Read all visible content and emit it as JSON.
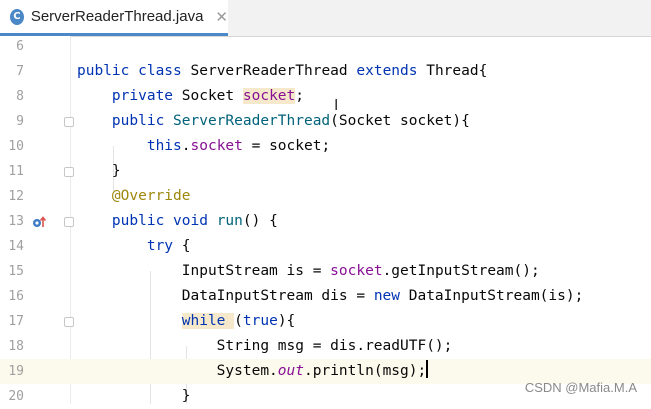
{
  "tab": {
    "icon_letter": "C",
    "label": "ServerReaderThread.java",
    "close": "✕"
  },
  "lines": [
    {
      "n": "6",
      "tokens": []
    },
    {
      "n": "7",
      "tokens": [
        {
          "t": "public class ",
          "c": "k"
        },
        {
          "t": "ServerReaderThread "
        },
        {
          "t": "extends ",
          "c": "k"
        },
        {
          "t": "Thread{"
        }
      ]
    },
    {
      "n": "8",
      "tokens": [
        {
          "t": "    "
        },
        {
          "t": "private ",
          "c": "k"
        },
        {
          "t": "Socket "
        },
        {
          "t": "socket",
          "c": "f hl"
        },
        {
          "t": ";"
        }
      ]
    },
    {
      "n": "9",
      "fold": true,
      "tokens": [
        {
          "t": "    "
        },
        {
          "t": "public ",
          "c": "k"
        },
        {
          "t": "ServerReaderThread",
          "c": "m"
        },
        {
          "t": "(Socket socket){"
        }
      ]
    },
    {
      "n": "10",
      "tokens": [
        {
          "t": "        "
        },
        {
          "t": "this",
          "c": "k"
        },
        {
          "t": "."
        },
        {
          "t": "socket",
          "c": "f"
        },
        {
          "t": " = socket;"
        }
      ]
    },
    {
      "n": "11",
      "fold": true,
      "tokens": [
        {
          "t": "    }"
        }
      ]
    },
    {
      "n": "12",
      "tokens": [
        {
          "t": "    "
        },
        {
          "t": "@Override",
          "c": "a"
        }
      ]
    },
    {
      "n": "13",
      "fold": true,
      "override": true,
      "tokens": [
        {
          "t": "    "
        },
        {
          "t": "public void ",
          "c": "k"
        },
        {
          "t": "run",
          "c": "m"
        },
        {
          "t": "() {"
        }
      ]
    },
    {
      "n": "14",
      "tokens": [
        {
          "t": "        "
        },
        {
          "t": "try ",
          "c": "k"
        },
        {
          "t": "{"
        }
      ]
    },
    {
      "n": "15",
      "tokens": [
        {
          "t": "            InputStream is = "
        },
        {
          "t": "socket",
          "c": "f"
        },
        {
          "t": ".getInputStream();"
        }
      ]
    },
    {
      "n": "16",
      "tokens": [
        {
          "t": "            DataInputStream dis = "
        },
        {
          "t": "new ",
          "c": "k"
        },
        {
          "t": "DataInputStream(is);"
        }
      ]
    },
    {
      "n": "17",
      "fold": true,
      "tokens": [
        {
          "t": "            "
        },
        {
          "t": "while ",
          "c": "k hl"
        },
        {
          "t": "("
        },
        {
          "t": "true",
          "c": "k"
        },
        {
          "t": "){"
        }
      ]
    },
    {
      "n": "18",
      "tokens": [
        {
          "t": "                String msg = dis.readUTF();"
        }
      ]
    },
    {
      "n": "19",
      "current": true,
      "caret": true,
      "tokens": [
        {
          "t": "                System."
        },
        {
          "t": "out",
          "c": "i"
        },
        {
          "t": ".println(msg);"
        }
      ]
    },
    {
      "n": "20",
      "tokens": [
        {
          "t": "            }"
        }
      ]
    }
  ],
  "watermark": "CSDN @Mafia.M.A"
}
